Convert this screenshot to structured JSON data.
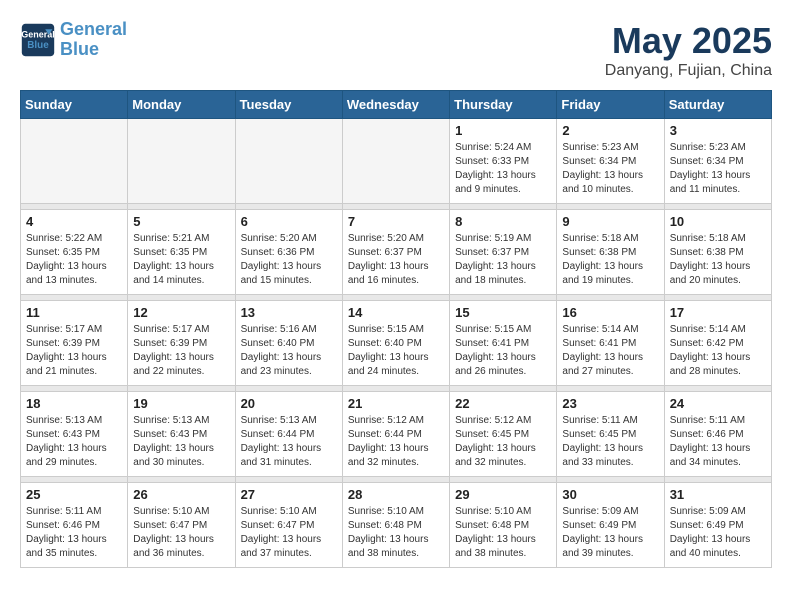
{
  "header": {
    "logo_line1": "General",
    "logo_line2": "Blue",
    "title": "May 2025",
    "subtitle": "Danyang, Fujian, China"
  },
  "weekdays": [
    "Sunday",
    "Monday",
    "Tuesday",
    "Wednesday",
    "Thursday",
    "Friday",
    "Saturday"
  ],
  "weeks": [
    [
      {
        "day": "",
        "info": ""
      },
      {
        "day": "",
        "info": ""
      },
      {
        "day": "",
        "info": ""
      },
      {
        "day": "",
        "info": ""
      },
      {
        "day": "1",
        "info": "Sunrise: 5:24 AM\nSunset: 6:33 PM\nDaylight: 13 hours\nand 9 minutes."
      },
      {
        "day": "2",
        "info": "Sunrise: 5:23 AM\nSunset: 6:34 PM\nDaylight: 13 hours\nand 10 minutes."
      },
      {
        "day": "3",
        "info": "Sunrise: 5:23 AM\nSunset: 6:34 PM\nDaylight: 13 hours\nand 11 minutes."
      }
    ],
    [
      {
        "day": "4",
        "info": "Sunrise: 5:22 AM\nSunset: 6:35 PM\nDaylight: 13 hours\nand 13 minutes."
      },
      {
        "day": "5",
        "info": "Sunrise: 5:21 AM\nSunset: 6:35 PM\nDaylight: 13 hours\nand 14 minutes."
      },
      {
        "day": "6",
        "info": "Sunrise: 5:20 AM\nSunset: 6:36 PM\nDaylight: 13 hours\nand 15 minutes."
      },
      {
        "day": "7",
        "info": "Sunrise: 5:20 AM\nSunset: 6:37 PM\nDaylight: 13 hours\nand 16 minutes."
      },
      {
        "day": "8",
        "info": "Sunrise: 5:19 AM\nSunset: 6:37 PM\nDaylight: 13 hours\nand 18 minutes."
      },
      {
        "day": "9",
        "info": "Sunrise: 5:18 AM\nSunset: 6:38 PM\nDaylight: 13 hours\nand 19 minutes."
      },
      {
        "day": "10",
        "info": "Sunrise: 5:18 AM\nSunset: 6:38 PM\nDaylight: 13 hours\nand 20 minutes."
      }
    ],
    [
      {
        "day": "11",
        "info": "Sunrise: 5:17 AM\nSunset: 6:39 PM\nDaylight: 13 hours\nand 21 minutes."
      },
      {
        "day": "12",
        "info": "Sunrise: 5:17 AM\nSunset: 6:39 PM\nDaylight: 13 hours\nand 22 minutes."
      },
      {
        "day": "13",
        "info": "Sunrise: 5:16 AM\nSunset: 6:40 PM\nDaylight: 13 hours\nand 23 minutes."
      },
      {
        "day": "14",
        "info": "Sunrise: 5:15 AM\nSunset: 6:40 PM\nDaylight: 13 hours\nand 24 minutes."
      },
      {
        "day": "15",
        "info": "Sunrise: 5:15 AM\nSunset: 6:41 PM\nDaylight: 13 hours\nand 26 minutes."
      },
      {
        "day": "16",
        "info": "Sunrise: 5:14 AM\nSunset: 6:41 PM\nDaylight: 13 hours\nand 27 minutes."
      },
      {
        "day": "17",
        "info": "Sunrise: 5:14 AM\nSunset: 6:42 PM\nDaylight: 13 hours\nand 28 minutes."
      }
    ],
    [
      {
        "day": "18",
        "info": "Sunrise: 5:13 AM\nSunset: 6:43 PM\nDaylight: 13 hours\nand 29 minutes."
      },
      {
        "day": "19",
        "info": "Sunrise: 5:13 AM\nSunset: 6:43 PM\nDaylight: 13 hours\nand 30 minutes."
      },
      {
        "day": "20",
        "info": "Sunrise: 5:13 AM\nSunset: 6:44 PM\nDaylight: 13 hours\nand 31 minutes."
      },
      {
        "day": "21",
        "info": "Sunrise: 5:12 AM\nSunset: 6:44 PM\nDaylight: 13 hours\nand 32 minutes."
      },
      {
        "day": "22",
        "info": "Sunrise: 5:12 AM\nSunset: 6:45 PM\nDaylight: 13 hours\nand 32 minutes."
      },
      {
        "day": "23",
        "info": "Sunrise: 5:11 AM\nSunset: 6:45 PM\nDaylight: 13 hours\nand 33 minutes."
      },
      {
        "day": "24",
        "info": "Sunrise: 5:11 AM\nSunset: 6:46 PM\nDaylight: 13 hours\nand 34 minutes."
      }
    ],
    [
      {
        "day": "25",
        "info": "Sunrise: 5:11 AM\nSunset: 6:46 PM\nDaylight: 13 hours\nand 35 minutes."
      },
      {
        "day": "26",
        "info": "Sunrise: 5:10 AM\nSunset: 6:47 PM\nDaylight: 13 hours\nand 36 minutes."
      },
      {
        "day": "27",
        "info": "Sunrise: 5:10 AM\nSunset: 6:47 PM\nDaylight: 13 hours\nand 37 minutes."
      },
      {
        "day": "28",
        "info": "Sunrise: 5:10 AM\nSunset: 6:48 PM\nDaylight: 13 hours\nand 38 minutes."
      },
      {
        "day": "29",
        "info": "Sunrise: 5:10 AM\nSunset: 6:48 PM\nDaylight: 13 hours\nand 38 minutes."
      },
      {
        "day": "30",
        "info": "Sunrise: 5:09 AM\nSunset: 6:49 PM\nDaylight: 13 hours\nand 39 minutes."
      },
      {
        "day": "31",
        "info": "Sunrise: 5:09 AM\nSunset: 6:49 PM\nDaylight: 13 hours\nand 40 minutes."
      }
    ]
  ]
}
